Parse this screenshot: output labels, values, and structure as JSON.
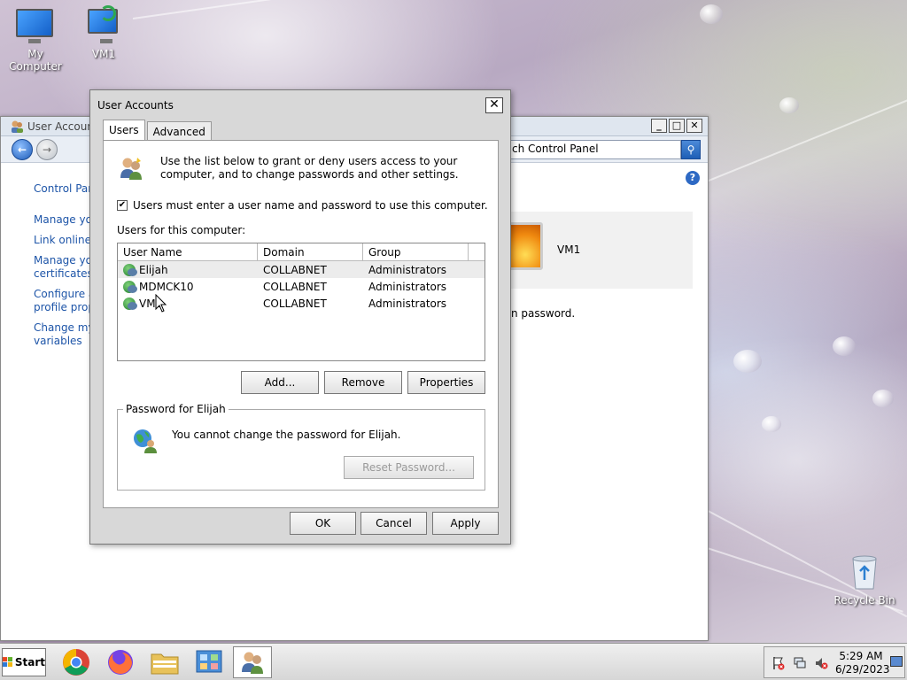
{
  "desktop": {
    "icons": [
      {
        "label": "My Computer"
      },
      {
        "label": "VM1"
      }
    ],
    "recycle_bin": "Recycle Bin"
  },
  "control_panel": {
    "title": "User Account",
    "search_text": "ch Control Panel",
    "links": [
      "Control Pan",
      "Manage you",
      "Link online I",
      "Manage you",
      "certificates",
      "Configure a",
      "profile prop",
      "Change my",
      "variables"
    ],
    "user_name": "VM1",
    "password_note": "n password."
  },
  "dialog": {
    "title": "User Accounts",
    "close": "✕",
    "tabs": [
      {
        "label": "Users",
        "active": true
      },
      {
        "label": "Advanced",
        "active": false
      }
    ],
    "intro": "Use the list below to grant or deny users access to your computer, and to change passwords and other settings.",
    "require_password_label": "Users must enter a user name and password to use this computer.",
    "require_password_checked": true,
    "users_label": "Users for this computer:",
    "columns": [
      "User Name",
      "Domain",
      "Group"
    ],
    "users": [
      {
        "name": "Elijah",
        "domain": "COLLABNET",
        "group": "Administrators",
        "selected": true
      },
      {
        "name": "MDMCK10",
        "domain": "COLLABNET",
        "group": "Administrators",
        "selected": false
      },
      {
        "name": "VM1",
        "domain": "COLLABNET",
        "group": "Administrators",
        "selected": false
      }
    ],
    "buttons": {
      "add": "Add...",
      "remove": "Remove",
      "properties": "Properties"
    },
    "password_group_title": "Password for Elijah",
    "password_message": "You cannot change the password for Elijah.",
    "reset_password": "Reset Password...",
    "footer": {
      "ok": "OK",
      "cancel": "Cancel",
      "apply": "Apply"
    }
  },
  "taskbar": {
    "start": "Start",
    "time": "5:29 AM",
    "date": "6/29/2023"
  }
}
